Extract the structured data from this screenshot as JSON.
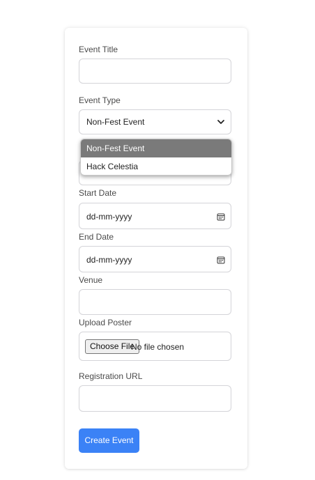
{
  "form": {
    "event_title": {
      "label": "Event Title",
      "value": ""
    },
    "event_type": {
      "label": "Event Type",
      "selected": "Non-Fest Event",
      "options": [
        "Non-Fest Event",
        "Hack Celestia"
      ]
    },
    "start_date": {
      "label": "Start Date",
      "placeholder": "dd-mm-yyyy"
    },
    "end_date": {
      "label": "End Date",
      "placeholder": "dd-mm-yyyy"
    },
    "venue": {
      "label": "Venue",
      "value": ""
    },
    "upload_poster": {
      "label": "Upload Poster",
      "button": "Choose File",
      "status": "No file chosen"
    },
    "registration_url": {
      "label": "Registration URL",
      "value": ""
    },
    "submit_label": "Create Event"
  },
  "colors": {
    "primary_button": "#3b82f6",
    "option_highlight": "#7a7a7a",
    "border": "#d4d4d8"
  },
  "icons": {
    "select": "chevron-down-icon",
    "date": "calendar-icon"
  }
}
